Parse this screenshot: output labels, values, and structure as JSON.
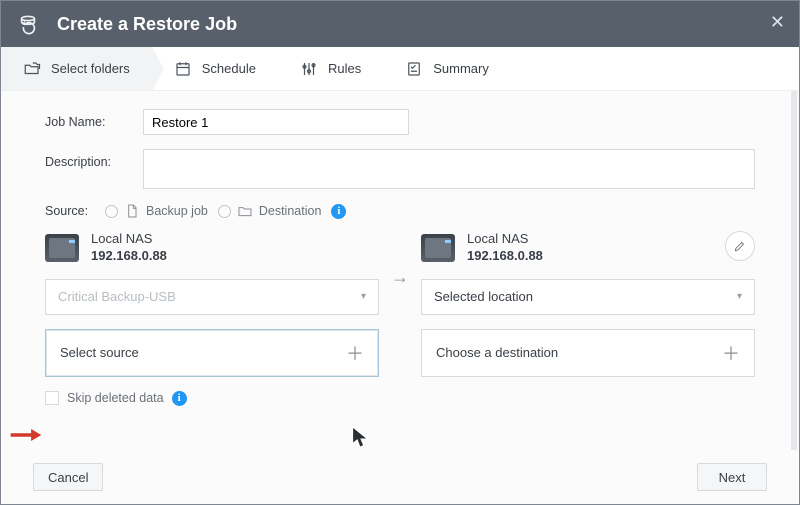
{
  "title": "Create a Restore Job",
  "tabs": {
    "select_folders": "Select folders",
    "schedule": "Schedule",
    "rules": "Rules",
    "summary": "Summary"
  },
  "labels": {
    "job_name": "Job Name:",
    "description": "Description:",
    "source": "Source:"
  },
  "job_name_value": "Restore 1",
  "description_value": "",
  "source_options": {
    "backup_job": "Backup job",
    "destination": "Destination"
  },
  "source_device": {
    "name": "Local NAS",
    "ip": "192.168.0.88"
  },
  "dest_device": {
    "name": "Local NAS",
    "ip": "192.168.0.88"
  },
  "source_select_disabled": "Critical Backup-USB",
  "dest_select_label": "Selected location",
  "source_picker": "Select source",
  "dest_picker": "Choose a destination",
  "skip_deleted": "Skip deleted data",
  "footer": {
    "cancel": "Cancel",
    "next": "Next"
  },
  "info_glyph": "i"
}
